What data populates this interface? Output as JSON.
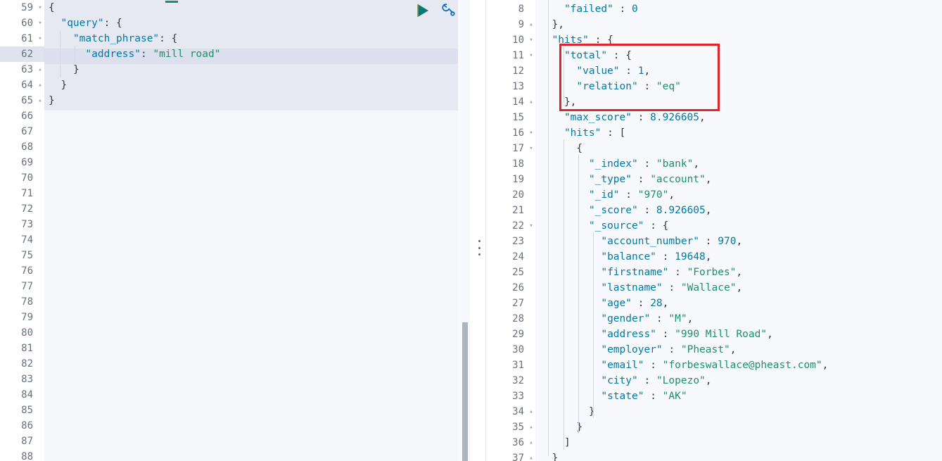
{
  "app": {
    "name": "kibana-dev-tools-console",
    "colors": {
      "key": "#0079a5",
      "string": "#1e8f6e",
      "number": "#0079a5",
      "punctuation": "#343741",
      "annotation": "#e0242a",
      "editor_bg": "#f4f6fa",
      "response_bg": "#f7f9fc",
      "selection_bg": "#e6e9f2",
      "active_line_bg": "#dcdfec",
      "play_icon": "#017d73",
      "wrench_icon": "#006bb4",
      "scrollbar": "#aeb4bf"
    }
  },
  "toolbar": {
    "play_label": "play-button",
    "play_title": "Click to send request",
    "wrench_label": "wrench-button",
    "wrench_title": "Open documentation / auto indent"
  },
  "splitter": {
    "grip_label": "drag-handle"
  },
  "request_editor": {
    "name": "request-editor",
    "first_line": 59,
    "active_line": 62,
    "selection_start_line": 59,
    "selection_end_line": 65,
    "lines": [
      {
        "num": "59",
        "fold": "▾",
        "text": "{"
      },
      {
        "num": "60",
        "fold": "▾",
        "text": "  \"query\": {"
      },
      {
        "num": "61",
        "fold": "▾",
        "text": "    \"match_phrase\": {"
      },
      {
        "num": "62",
        "fold": "",
        "text": "      \"address\": \"mill road\""
      },
      {
        "num": "63",
        "fold": "▴",
        "text": "    }"
      },
      {
        "num": "64",
        "fold": "▴",
        "text": "  }"
      },
      {
        "num": "65",
        "fold": "▴",
        "text": "}"
      },
      {
        "num": "66",
        "fold": "",
        "text": ""
      },
      {
        "num": "67",
        "fold": "",
        "text": ""
      },
      {
        "num": "68",
        "fold": "",
        "text": ""
      },
      {
        "num": "69",
        "fold": "",
        "text": ""
      },
      {
        "num": "70",
        "fold": "",
        "text": ""
      },
      {
        "num": "71",
        "fold": "",
        "text": ""
      },
      {
        "num": "72",
        "fold": "",
        "text": ""
      },
      {
        "num": "73",
        "fold": "",
        "text": ""
      },
      {
        "num": "74",
        "fold": "",
        "text": ""
      },
      {
        "num": "75",
        "fold": "",
        "text": ""
      },
      {
        "num": "76",
        "fold": "",
        "text": ""
      },
      {
        "num": "77",
        "fold": "",
        "text": ""
      },
      {
        "num": "78",
        "fold": "",
        "text": ""
      },
      {
        "num": "79",
        "fold": "",
        "text": ""
      },
      {
        "num": "80",
        "fold": "",
        "text": ""
      },
      {
        "num": "81",
        "fold": "",
        "text": ""
      },
      {
        "num": "82",
        "fold": "",
        "text": ""
      },
      {
        "num": "83",
        "fold": "",
        "text": ""
      },
      {
        "num": "84",
        "fold": "",
        "text": ""
      },
      {
        "num": "85",
        "fold": "",
        "text": ""
      },
      {
        "num": "86",
        "fold": "",
        "text": ""
      },
      {
        "num": "87",
        "fold": "",
        "text": ""
      },
      {
        "num": "88",
        "fold": "",
        "text": ""
      }
    ]
  },
  "response_editor": {
    "name": "response-editor",
    "first_line": 8,
    "lines": [
      {
        "num": "8",
        "fold": "",
        "text": "    \"failed\" : 0"
      },
      {
        "num": "9",
        "fold": "▴",
        "text": "  },"
      },
      {
        "num": "10",
        "fold": "▾",
        "text": "  \"hits\" : {"
      },
      {
        "num": "11",
        "fold": "▾",
        "text": "    \"total\" : {"
      },
      {
        "num": "12",
        "fold": "",
        "text": "      \"value\" : 1,"
      },
      {
        "num": "13",
        "fold": "",
        "text": "      \"relation\" : \"eq\""
      },
      {
        "num": "14",
        "fold": "▴",
        "text": "    },"
      },
      {
        "num": "15",
        "fold": "",
        "text": "    \"max_score\" : 8.926605,"
      },
      {
        "num": "16",
        "fold": "▾",
        "text": "    \"hits\" : ["
      },
      {
        "num": "17",
        "fold": "▾",
        "text": "      {"
      },
      {
        "num": "18",
        "fold": "",
        "text": "        \"_index\" : \"bank\","
      },
      {
        "num": "19",
        "fold": "",
        "text": "        \"_type\" : \"account\","
      },
      {
        "num": "20",
        "fold": "",
        "text": "        \"_id\" : \"970\","
      },
      {
        "num": "21",
        "fold": "",
        "text": "        \"_score\" : 8.926605,"
      },
      {
        "num": "22",
        "fold": "▾",
        "text": "        \"_source\" : {"
      },
      {
        "num": "23",
        "fold": "",
        "text": "          \"account_number\" : 970,"
      },
      {
        "num": "24",
        "fold": "",
        "text": "          \"balance\" : 19648,"
      },
      {
        "num": "25",
        "fold": "",
        "text": "          \"firstname\" : \"Forbes\","
      },
      {
        "num": "26",
        "fold": "",
        "text": "          \"lastname\" : \"Wallace\","
      },
      {
        "num": "27",
        "fold": "",
        "text": "          \"age\" : 28,"
      },
      {
        "num": "28",
        "fold": "",
        "text": "          \"gender\" : \"M\","
      },
      {
        "num": "29",
        "fold": "",
        "text": "          \"address\" : \"990 Mill Road\","
      },
      {
        "num": "30",
        "fold": "",
        "text": "          \"employer\" : \"Pheast\","
      },
      {
        "num": "31",
        "fold": "",
        "text": "          \"email\" : \"forbeswallace@pheast.com\","
      },
      {
        "num": "32",
        "fold": "",
        "text": "          \"city\" : \"Lopezo\","
      },
      {
        "num": "33",
        "fold": "",
        "text": "          \"state\" : \"AK\""
      },
      {
        "num": "34",
        "fold": "▴",
        "text": "        }"
      },
      {
        "num": "35",
        "fold": "▴",
        "text": "      }"
      },
      {
        "num": "36",
        "fold": "▴",
        "text": "    ]"
      },
      {
        "num": "37",
        "fold": "▴",
        "text": "  }"
      }
    ]
  },
  "annotation": {
    "name": "highlight-rectangle",
    "covers_lines": "11-14",
    "color": "#e0242a",
    "content": "\"total\" : { \"value\" : 1, \"relation\" : \"eq\" },"
  }
}
